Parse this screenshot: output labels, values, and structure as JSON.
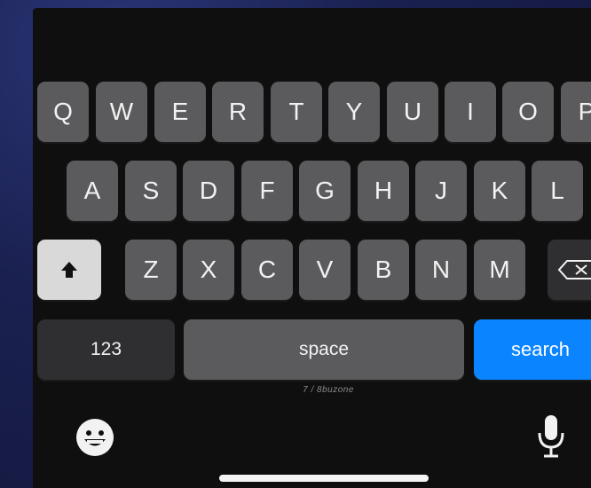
{
  "keyboard": {
    "row1": [
      "Q",
      "W",
      "E",
      "R",
      "T",
      "Y",
      "U",
      "I",
      "O",
      "P"
    ],
    "row2": [
      "A",
      "S",
      "D",
      "F",
      "G",
      "H",
      "J",
      "K",
      "L"
    ],
    "row3": [
      "Z",
      "X",
      "C",
      "V",
      "B",
      "N",
      "M"
    ],
    "numbers_label": "123",
    "space_label": "space",
    "search_label": "search",
    "shift_icon": "shift-arrow-icon",
    "backspace_icon": "backspace-icon",
    "emoji_icon": "emoji-icon",
    "mic_icon": "microphone-icon",
    "accent_color": "#0a84ff"
  },
  "watermark": "7 / 8buzone"
}
